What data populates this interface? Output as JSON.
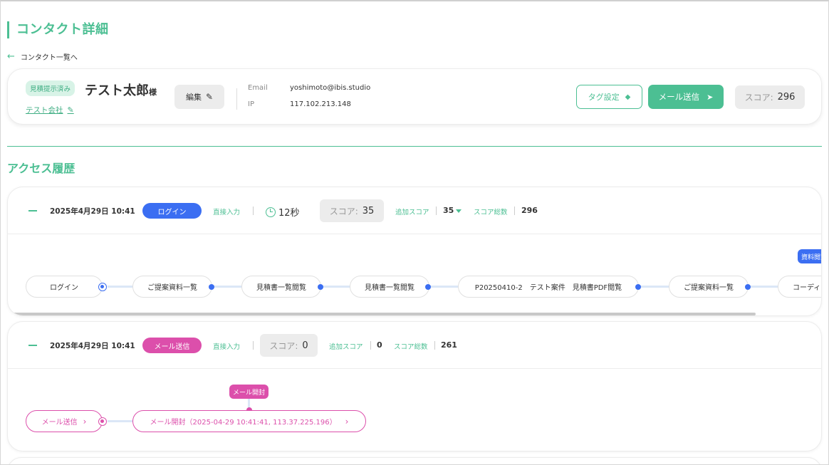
{
  "page": {
    "title": "コンタクト詳細",
    "back_link": "コンタクト一覧へ"
  },
  "profile": {
    "status_badge": "見積提示済み",
    "name": "テスト太郎",
    "honorific": "様",
    "company": "テスト会社",
    "edit_label": "編集",
    "email_label": "Email",
    "email_value": "yoshimoto@ibis.studio",
    "ip_label": "IP",
    "ip_value": "117.102.213.148",
    "tag_button": "タグ設定",
    "mail_button": "メール送信",
    "score_label": "スコア:",
    "score_value": "296"
  },
  "access_history": {
    "title": "アクセス履歴",
    "records": [
      {
        "date": "2025年4月29日 10:41",
        "type_pill": "ログイン",
        "type_color": "#3b6ef2",
        "source": "直接入力",
        "duration": "12秒",
        "score_label": "スコア:",
        "score_value": "35",
        "added_score_label": "追加スコア",
        "added_score_value": "35",
        "total_score_label": "スコア総数",
        "total_score_value": "296",
        "flag": "資料閲覧",
        "flow": [
          "ログイン",
          "ご提案資料一覧",
          "見積書一覧閲覧",
          "見積書一覧閲覧",
          "P20250410-2　テスト案件　見積書PDF閲覧",
          "ご提案資料一覧",
          "コーディネ"
        ]
      },
      {
        "date": "2025年4月29日 10:41",
        "type_pill": "メール送信",
        "type_color": "#dc4fab",
        "source": "直接入力",
        "score_label": "スコア:",
        "score_value": "0",
        "added_score_label": "追加スコア",
        "added_score_value": "0",
        "total_score_label": "スコア総数",
        "total_score_value": "261",
        "flag": "メール開封",
        "flow": [
          "メール送信",
          "メール開封（2025-04-29 10:41:41, 113.37.225.196）"
        ],
        "chevron": "›"
      }
    ]
  },
  "icons": {
    "back": "←",
    "pencil": "✎",
    "edit": "✎",
    "tag": "◆",
    "send": "➤"
  }
}
